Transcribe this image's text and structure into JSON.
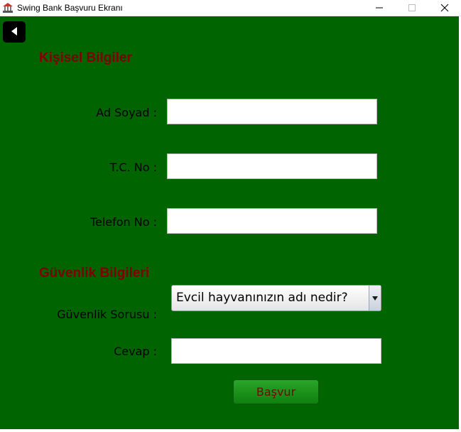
{
  "window": {
    "title": "Swing Bank Başvuru Ekranı",
    "app_icon": "bank-app-icon",
    "controls": [
      "minimize-icon",
      "maximize-icon",
      "close-icon"
    ]
  },
  "colors": {
    "background": "#006400",
    "section_title": "#800000",
    "button_text": "#800000",
    "button_fill": "#1a911a"
  },
  "back_button": {
    "icon": "back-arrow-icon"
  },
  "personal": {
    "title": "Kişisel Bilgiler",
    "name_label": "Ad Soyad :",
    "name_value": "",
    "tc_label": "T.C. No :",
    "tc_value": "",
    "phone_label": "Telefon No :",
    "phone_value": ""
  },
  "security": {
    "title": "Güvenlik Bilgileri",
    "question_label": "Güvenlik Sorusu :",
    "question_selected": "Evcil hayvanınızın adı nedir?",
    "answer_label": "Cevap :",
    "answer_value": ""
  },
  "submit_label": "Başvur"
}
